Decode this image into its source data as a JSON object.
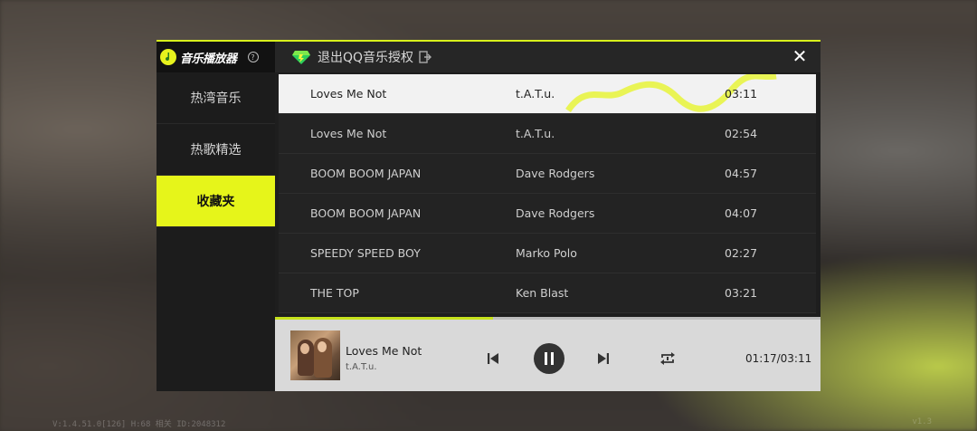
{
  "app": {
    "name": "音乐播放器",
    "help_icon": "question-circle-icon"
  },
  "header": {
    "auth_label": "退出QQ音乐授权",
    "close_label": "✕"
  },
  "sidebar": {
    "items": [
      {
        "label": "热湾音乐",
        "active": false
      },
      {
        "label": "热歌精选",
        "active": false
      },
      {
        "label": "收藏夹",
        "active": true
      }
    ]
  },
  "tracks": [
    {
      "title": "Loves Me Not",
      "artist": "t.A.T.u.",
      "duration": "03:11",
      "selected": true
    },
    {
      "title": "Loves Me Not",
      "artist": "t.A.T.u.",
      "duration": "02:54",
      "selected": false
    },
    {
      "title": "BOOM BOOM JAPAN",
      "artist": "Dave Rodgers",
      "duration": "04:57",
      "selected": false
    },
    {
      "title": "BOOM BOOM JAPAN",
      "artist": "Dave Rodgers",
      "duration": "04:07",
      "selected": false
    },
    {
      "title": "SPEEDY SPEED BOY",
      "artist": "Marko Polo",
      "duration": "02:27",
      "selected": false
    },
    {
      "title": "THE TOP",
      "artist": "Ken Blast",
      "duration": "03:21",
      "selected": false
    }
  ],
  "player": {
    "title": "Loves Me Not",
    "artist": "t.A.T.u.",
    "time": "01:17/03:11",
    "progress": 0.4
  },
  "background": {
    "footer_left": "V:1.4.51.0[126] H:68 相关 ID:2048312",
    "footer_right": "v1.3"
  },
  "colors": {
    "accent": "#e6f51a",
    "panel": "#1e1e1e"
  }
}
